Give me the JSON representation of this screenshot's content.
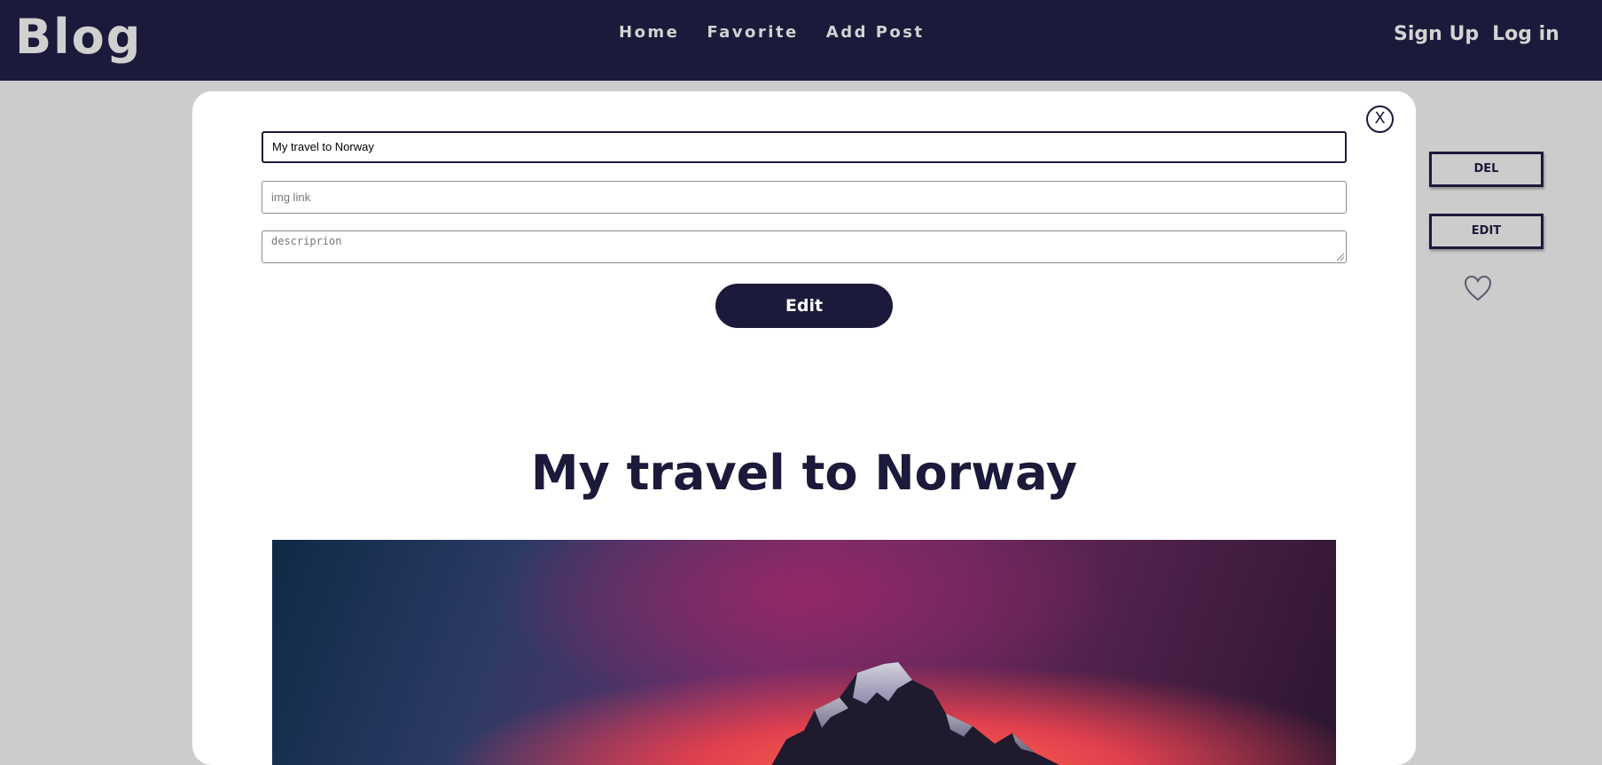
{
  "header": {
    "logo": "Blog",
    "nav": [
      {
        "label": "Home"
      },
      {
        "label": "Favorite"
      },
      {
        "label": "Add Post"
      }
    ],
    "auth": {
      "signup": "Sign Up",
      "login": "Log in"
    }
  },
  "modal": {
    "close_label": "X",
    "form": {
      "title_value": "My travel to Norway",
      "img_placeholder": "img link",
      "description_placeholder": "descriprion",
      "submit_label": "Edit"
    },
    "post": {
      "title": "My travel to Norway",
      "image_subject": "snowy mountain peak at sunset"
    }
  },
  "actions": {
    "delete_label": "DEL",
    "edit_label": "EDIT",
    "favorite_icon": "heart-outline-icon"
  },
  "colors": {
    "brand_dark": "#1b1a3a",
    "background": "#cccccc",
    "header_text": "#d3d3d3"
  }
}
